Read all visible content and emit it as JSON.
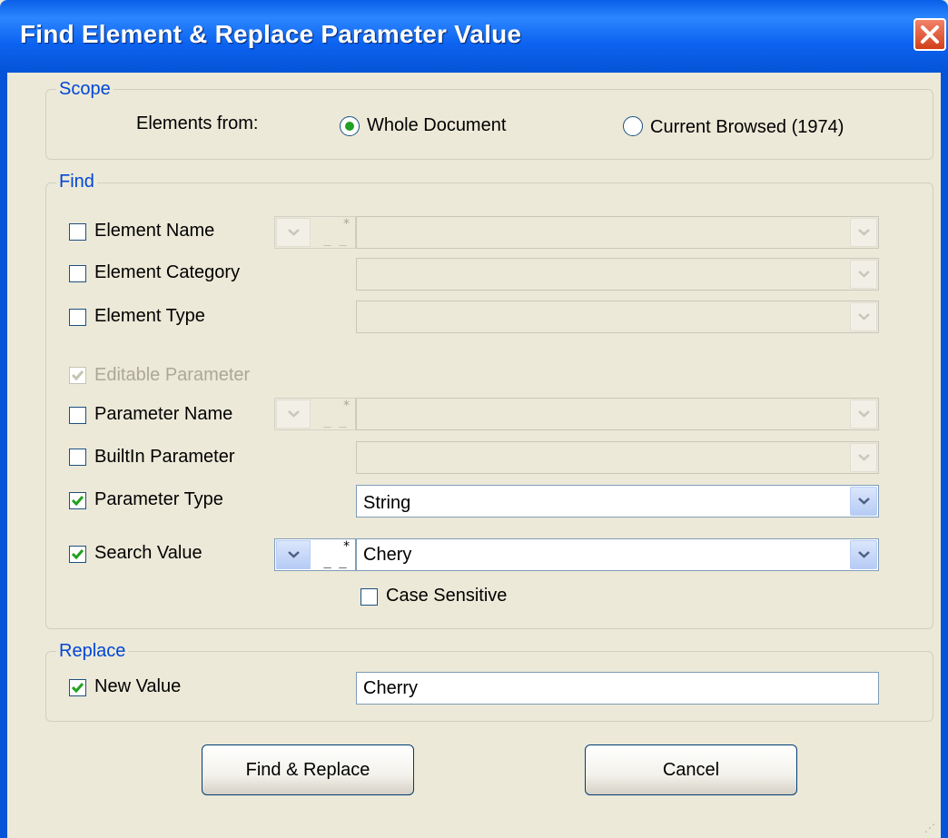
{
  "window": {
    "title": "Find Element & Replace Parameter Value",
    "close_icon": "close-icon"
  },
  "scope": {
    "legend": "Scope",
    "elements_from_label": "Elements from:",
    "options": [
      {
        "label": "Whole Document",
        "selected": true
      },
      {
        "label": "Current Browsed (1974)",
        "selected": false
      }
    ]
  },
  "find": {
    "legend": "Find",
    "element_name": {
      "label": "Element Name",
      "checked": false,
      "value": ""
    },
    "element_category": {
      "label": "Element Category",
      "checked": false,
      "value": ""
    },
    "element_type": {
      "label": "Element Type",
      "checked": false,
      "value": ""
    },
    "editable_parameter": {
      "label": "Editable Parameter",
      "checked": true,
      "enabled": false
    },
    "parameter_name": {
      "label": "Parameter Name",
      "checked": false,
      "value": ""
    },
    "builtin_parameter": {
      "label": "BuiltIn Parameter",
      "checked": false,
      "value": ""
    },
    "parameter_type": {
      "label": "Parameter Type",
      "checked": true,
      "value": "String"
    },
    "search_value": {
      "label": "Search Value",
      "checked": true,
      "value": "Chery"
    },
    "case_sensitive": {
      "label": "Case Sensitive",
      "checked": false
    }
  },
  "replace": {
    "legend": "Replace",
    "new_value": {
      "label": "New Value",
      "checked": true,
      "value": "Cherry"
    }
  },
  "buttons": {
    "find_replace": "Find & Replace",
    "cancel": "Cancel"
  },
  "colors": {
    "title_bar": "#0a5fe8",
    "legend_text": "#0046d5",
    "check_mark": "#21a121",
    "dialog_bg": "#ece9d8"
  }
}
